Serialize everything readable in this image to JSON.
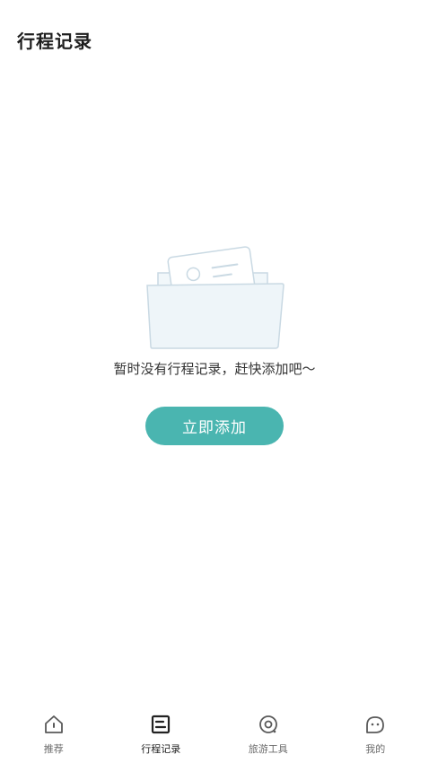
{
  "header": {
    "title": "行程记录"
  },
  "empty_state": {
    "message": "暂时没有行程记录，赶快添加吧～",
    "button_label": "立即添加"
  },
  "tabbar": {
    "tabs": [
      {
        "label": "推荐",
        "icon": "home-icon",
        "active": false
      },
      {
        "label": "行程记录",
        "icon": "record-icon",
        "active": true
      },
      {
        "label": "旅游工具",
        "icon": "eye-icon",
        "active": false
      },
      {
        "label": "我的",
        "icon": "profile-icon",
        "active": false
      }
    ]
  },
  "colors": {
    "accent": "#4ab5b0",
    "illustration_stroke": "#c9d9e3",
    "illustration_fill": "#f1f7fa"
  }
}
